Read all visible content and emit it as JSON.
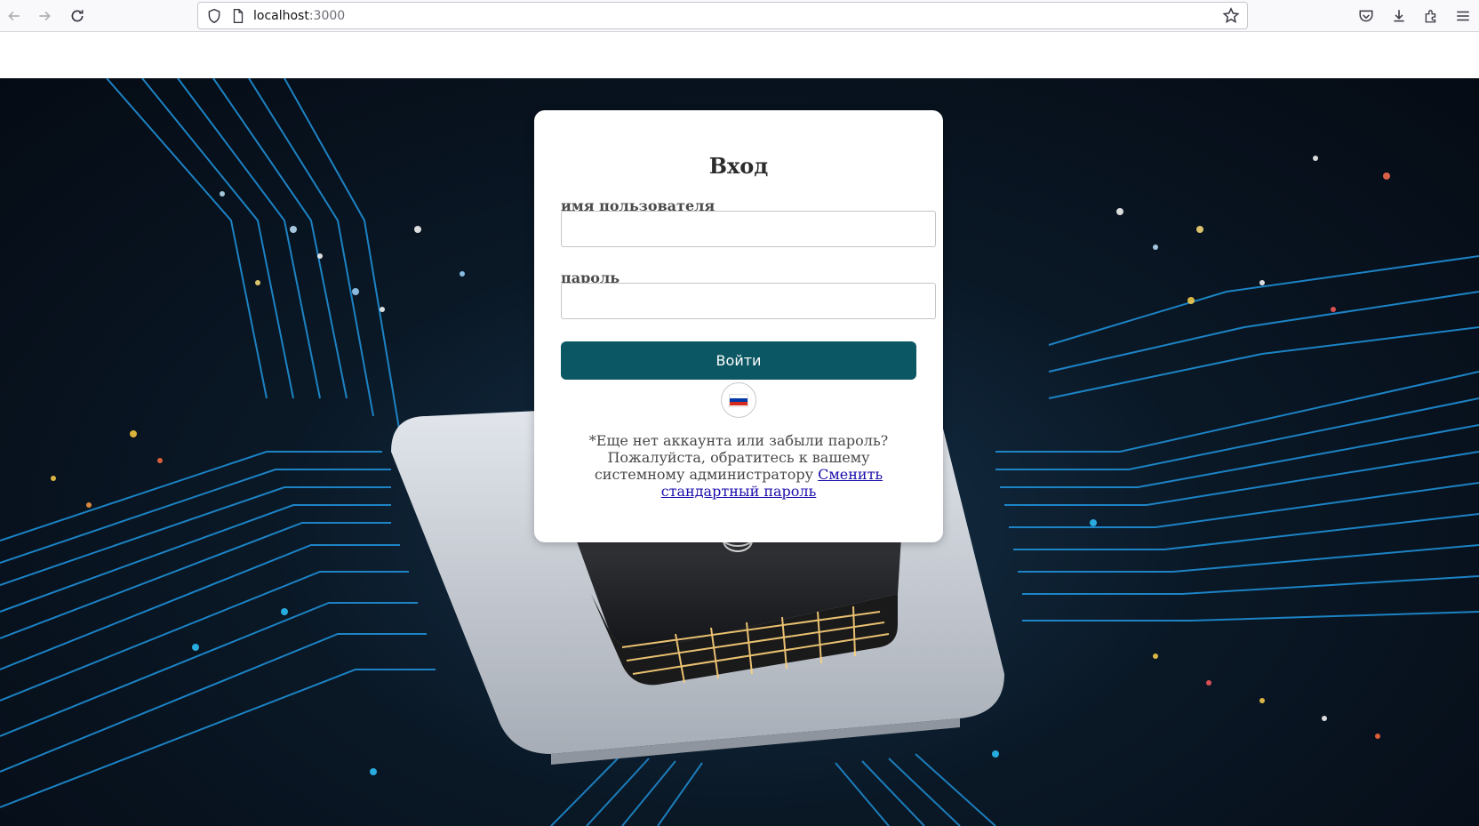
{
  "browser": {
    "url_host": "localhost",
    "url_port": ":3000",
    "icons": [
      "back-icon",
      "forward-icon",
      "reload-icon",
      "shield-icon",
      "page-icon",
      "bookmark-star-icon",
      "pocket-icon",
      "download-icon",
      "extensions-icon",
      "menu-icon"
    ]
  },
  "login": {
    "title": "Вход",
    "username_label": "имя пользователя",
    "username_value": "",
    "password_label": "пароль",
    "password_value": "",
    "submit_label": "Войти",
    "language_flag": "russia-flag-icon",
    "help_text": "*Еще нет аккаунта или забыли пароль? Пожалуйста, обратитесь к вашему системному администратору ",
    "change_password_link": "Сменить стандартный пароль"
  },
  "colors": {
    "button": "#0b5763",
    "link": "#1a0dab",
    "flag_white": "#ffffff",
    "flag_blue": "#0039a6",
    "flag_red": "#d52b1e"
  }
}
